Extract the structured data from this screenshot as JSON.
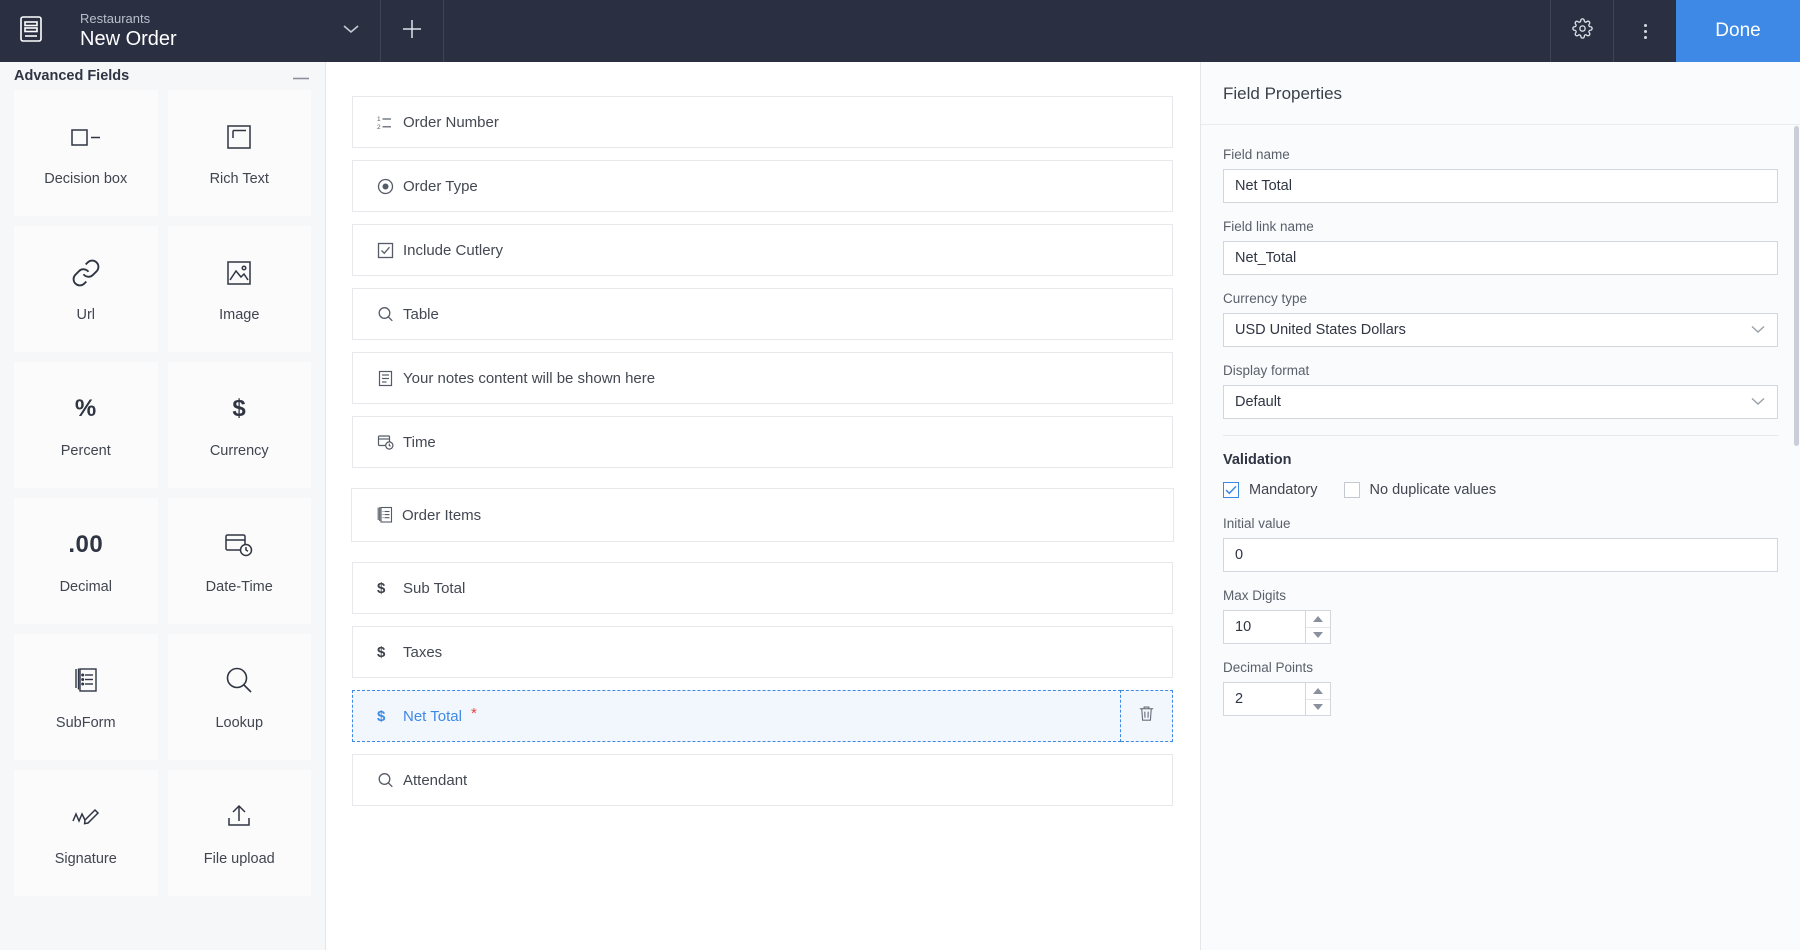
{
  "topbar": {
    "app_name": "Restaurants",
    "form_name": "New Order",
    "logo_icon": "form-builder-icon",
    "caret_icon": "chevron-down-icon",
    "add_icon": "plus-icon",
    "settings_icon": "gear-icon",
    "more_icon": "more-vertical-icon",
    "done_label": "Done",
    "accent_color": "#3e89e5",
    "bar_color": "#2a3042"
  },
  "left_panel": {
    "section_title": "Advanced Fields",
    "collapse_icon": "minus-icon",
    "fields": [
      {
        "label": "Decision box",
        "icon": "decision-box-icon",
        "icon_kind": "svg"
      },
      {
        "label": "Rich Text",
        "icon": "rich-text-icon",
        "icon_kind": "svg"
      },
      {
        "label": "Url",
        "icon": "link-icon",
        "icon_kind": "svg"
      },
      {
        "label": "Image",
        "icon": "image-icon",
        "icon_kind": "svg"
      },
      {
        "label": "Percent",
        "icon": "percent-icon",
        "icon_kind": "text",
        "glyph": "%"
      },
      {
        "label": "Currency",
        "icon": "dollar-icon",
        "icon_kind": "text",
        "glyph": "$"
      },
      {
        "label": "Decimal",
        "icon": "decimal-icon",
        "icon_kind": "text",
        "glyph": ".00"
      },
      {
        "label": "Date-Time",
        "icon": "date-time-icon",
        "icon_kind": "svg"
      },
      {
        "label": "SubForm",
        "icon": "subform-icon",
        "icon_kind": "svg"
      },
      {
        "label": "Lookup",
        "icon": "search-icon",
        "icon_kind": "svg"
      },
      {
        "label": "Signature",
        "icon": "signature-icon",
        "icon_kind": "svg"
      },
      {
        "label": "File upload",
        "icon": "upload-icon",
        "icon_kind": "svg"
      }
    ]
  },
  "canvas": {
    "rows": [
      {
        "label": "Order Number",
        "icon": "number-list-icon",
        "type": "number",
        "selected": false,
        "wide": false,
        "required": false
      },
      {
        "label": "Order Type",
        "icon": "radio-icon",
        "type": "radio",
        "selected": false,
        "wide": false,
        "required": false
      },
      {
        "label": "Include Cutlery",
        "icon": "checkbox-icon",
        "type": "checkbox",
        "selected": false,
        "wide": false,
        "required": false
      },
      {
        "label": "Table",
        "icon": "search-icon",
        "type": "lookup",
        "selected": false,
        "wide": false,
        "required": false
      },
      {
        "label": "Your notes content will be shown here",
        "icon": "notes-icon",
        "type": "notes",
        "selected": false,
        "wide": false,
        "required": false
      },
      {
        "label": "Time",
        "icon": "date-time-icon",
        "type": "time",
        "selected": false,
        "wide": false,
        "required": false
      },
      {
        "label": "Order Items",
        "icon": "subform-icon",
        "type": "subform",
        "selected": false,
        "wide": true,
        "required": false
      },
      {
        "label": "Sub Total",
        "icon": "dollar-icon",
        "type": "currency",
        "selected": false,
        "wide": false,
        "required": false
      },
      {
        "label": "Taxes",
        "icon": "dollar-icon",
        "type": "currency",
        "selected": false,
        "wide": false,
        "required": false
      },
      {
        "label": "Net Total",
        "icon": "dollar-icon",
        "type": "currency",
        "selected": true,
        "wide": false,
        "required": true
      },
      {
        "label": "Attendant",
        "icon": "search-icon",
        "type": "lookup",
        "selected": false,
        "wide": false,
        "required": false
      }
    ],
    "delete_icon": "trash-icon",
    "required_marker": "*"
  },
  "right_panel": {
    "title": "Field Properties",
    "field_name_label": "Field name",
    "field_name_value": "Net Total",
    "field_link_name_label": "Field link name",
    "field_link_name_value": "Net_Total",
    "currency_type_label": "Currency type",
    "currency_type_value": "USD United States Dollars",
    "display_format_label": "Display format",
    "display_format_value": "Default",
    "validation_title": "Validation",
    "mandatory_label": "Mandatory",
    "mandatory_checked": true,
    "no_duplicate_label": "No duplicate values",
    "no_duplicate_checked": false,
    "initial_value_label": "Initial value",
    "initial_value": "0",
    "max_digits_label": "Max Digits",
    "max_digits_value": "10",
    "decimal_points_label": "Decimal Points",
    "decimal_points_value": "2",
    "dropdown_icon": "chevron-down-icon"
  }
}
